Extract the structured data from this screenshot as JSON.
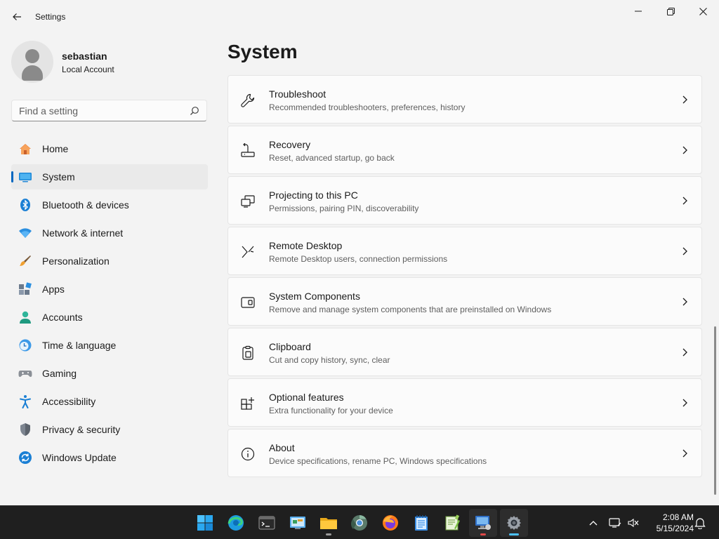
{
  "window": {
    "title": "Settings"
  },
  "user": {
    "name": "sebastian",
    "account_type": "Local Account"
  },
  "search": {
    "placeholder": "Find a setting"
  },
  "nav": [
    {
      "label": "Home",
      "icon": "home-icon"
    },
    {
      "label": "System",
      "icon": "system-icon",
      "active": true
    },
    {
      "label": "Bluetooth & devices",
      "icon": "bluetooth-icon"
    },
    {
      "label": "Network & internet",
      "icon": "network-icon"
    },
    {
      "label": "Personalization",
      "icon": "brush-icon"
    },
    {
      "label": "Apps",
      "icon": "apps-icon"
    },
    {
      "label": "Accounts",
      "icon": "accounts-icon"
    },
    {
      "label": "Time & language",
      "icon": "clock-globe-icon"
    },
    {
      "label": "Gaming",
      "icon": "gamepad-icon"
    },
    {
      "label": "Accessibility",
      "icon": "accessibility-icon"
    },
    {
      "label": "Privacy & security",
      "icon": "shield-icon"
    },
    {
      "label": "Windows Update",
      "icon": "update-icon"
    }
  ],
  "main": {
    "title": "System",
    "cards": [
      {
        "title": "Troubleshoot",
        "subtitle": "Recommended troubleshooters, preferences, history",
        "icon": "wrench-icon"
      },
      {
        "title": "Recovery",
        "subtitle": "Reset, advanced startup, go back",
        "icon": "recovery-icon"
      },
      {
        "title": "Projecting to this PC",
        "subtitle": "Permissions, pairing PIN, discoverability",
        "icon": "projecting-icon"
      },
      {
        "title": "Remote Desktop",
        "subtitle": "Remote Desktop users, connection permissions",
        "icon": "remote-desktop-icon"
      },
      {
        "title": "System Components",
        "subtitle": "Remove and manage system components that are preinstalled on Windows",
        "icon": "components-icon"
      },
      {
        "title": "Clipboard",
        "subtitle": "Cut and copy history, sync, clear",
        "icon": "clipboard-icon"
      },
      {
        "title": "Optional features",
        "subtitle": "Extra functionality for your device",
        "icon": "optional-features-icon"
      },
      {
        "title": "About",
        "subtitle": "Device specifications, rename PC, Windows specifications",
        "icon": "info-icon"
      }
    ]
  },
  "taskbar": {
    "apps": [
      "start",
      "edge",
      "terminal",
      "control-panel",
      "file-explorer",
      "chrome",
      "firefox",
      "notepad",
      "notepad-plus",
      "remote-desktop",
      "settings"
    ],
    "clock": {
      "time": "2:08 AM",
      "date": "5/15/2024"
    }
  },
  "colors": {
    "accent": "#0067c0",
    "taskbar_bg": "#1f1f1f",
    "page_bg": "#f3f3f3"
  }
}
